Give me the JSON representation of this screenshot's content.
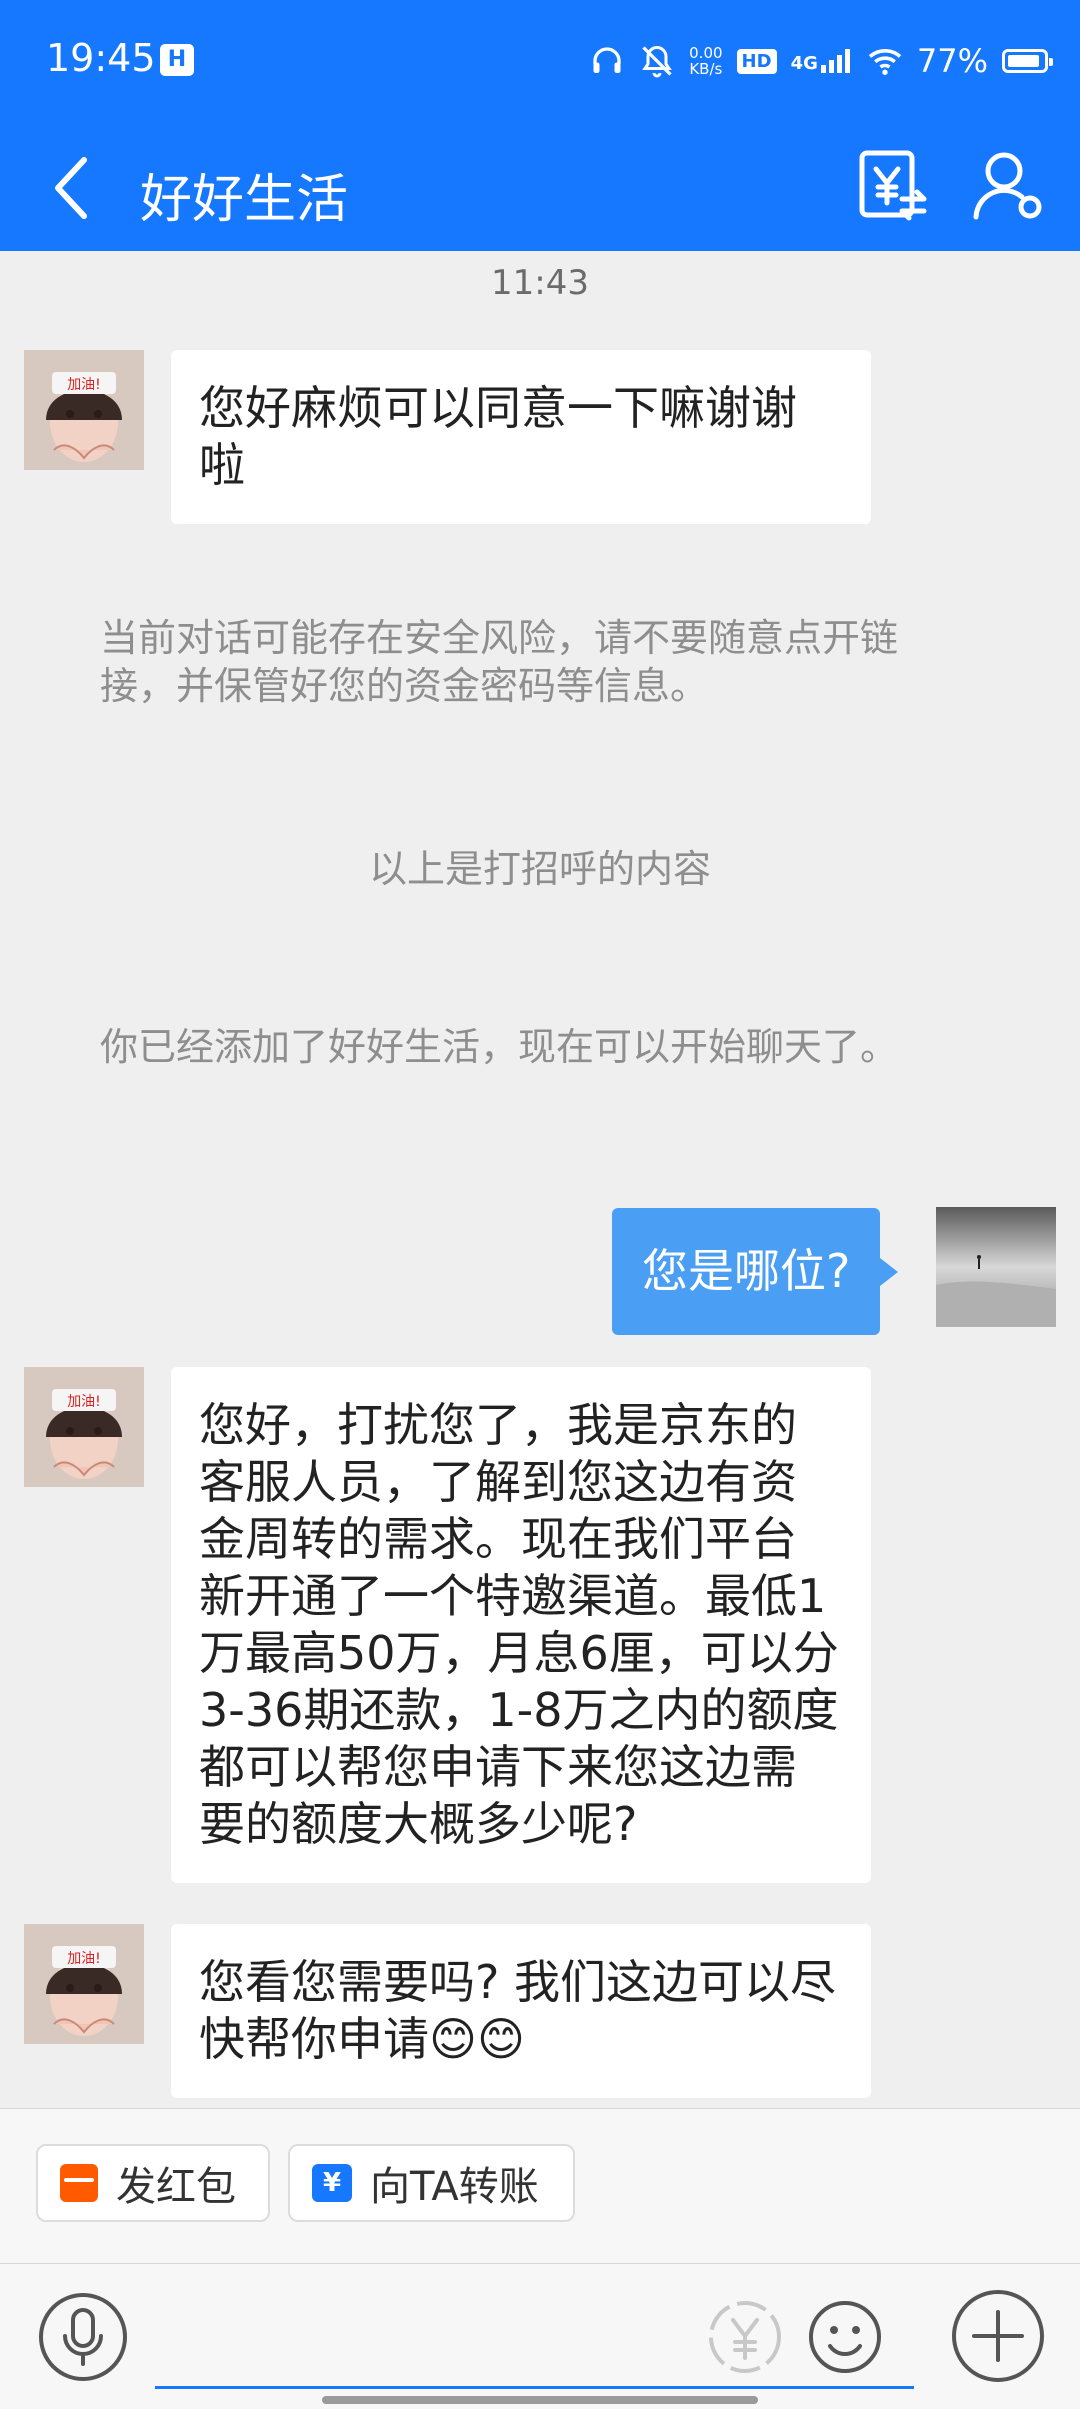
{
  "status_bar": {
    "time": "19:45",
    "app_badge": "H",
    "net_speed_value": "0.00",
    "net_speed_unit": "KB/s",
    "hd_label": "HD",
    "network_label": "4G",
    "battery_text": "77%",
    "battery_level": 0.77
  },
  "header": {
    "title": "好好生活"
  },
  "chat": {
    "timestamp": "11:43",
    "messages": [
      {
        "direction": "incoming",
        "text": "您好麻烦可以同意一下嘛谢谢啦"
      },
      {
        "direction": "outgoing",
        "text": "您是哪位?"
      },
      {
        "direction": "incoming",
        "text": "您好，打扰您了，我是京东的客服人员，了解到您这边有资金周转的需求。现在我们平台新开通了一个特邀渠道。最低1万最高50万，月息6厘，可以分3-36期还款，1-8万之内的额度都可以帮您申请下来您这边需要的额度大概多少呢?"
      },
      {
        "direction": "incoming",
        "text": "您看您需要吗? 我们这边可以尽快帮你申请😊😊"
      }
    ],
    "system_notices": [
      "当前对话可能存在安全风险，请不要随意点开链接，并保管好您的资金密码等信息。",
      "以上是打招呼的内容",
      "你已经添加了好好生活，现在可以开始聊天了。"
    ]
  },
  "toolbar": {
    "red_packet_label": "发红包",
    "transfer_label": "向TA转账"
  },
  "input": {
    "value": "",
    "placeholder": ""
  },
  "colors": {
    "brand_blue": "#1677ff",
    "outgoing_bubble": "#4a9ff5",
    "red_packet": "#ff5a00"
  },
  "icons": [
    "back-arrow-icon",
    "transfer-money-icon",
    "profile-settings-icon",
    "headphones-icon",
    "mute-icon",
    "wifi-icon",
    "signal-icon",
    "battery-icon",
    "voice-icon",
    "yen-icon",
    "emoji-icon",
    "plus-icon",
    "red-packet-icon",
    "transfer-icon"
  ]
}
